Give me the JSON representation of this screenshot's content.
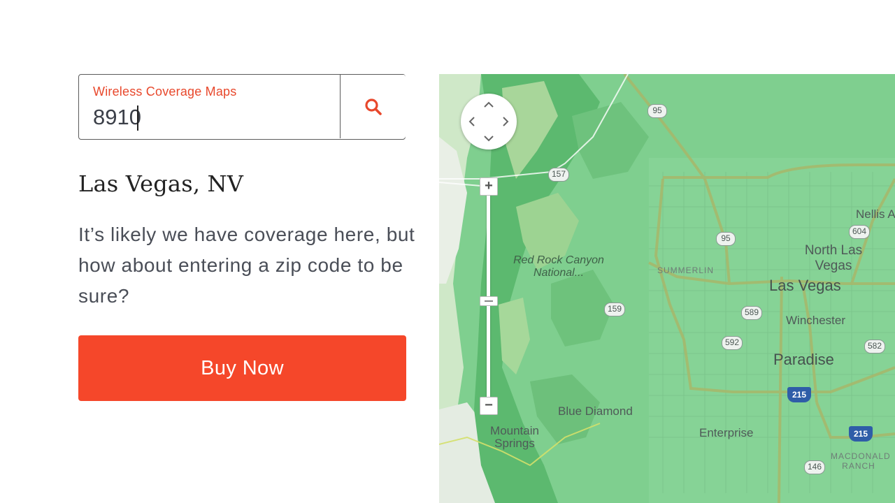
{
  "search": {
    "label": "Wireless Coverage Maps",
    "value": "8910",
    "button_icon": "search-icon"
  },
  "result": {
    "city": "Las Vegas, NV",
    "message": "It’s likely we have coverage here, but how about entering a zip code to be sure?"
  },
  "buy_button": {
    "label": "Buy Now"
  },
  "colors": {
    "accent": "#f5472a",
    "label_orange": "#e8482c",
    "map_coverage_green": "#7fcf8f"
  },
  "map": {
    "controls": {
      "pan_icon": "pan-arrows-icon",
      "zoom_in": "+",
      "zoom_out": "−"
    },
    "places": {
      "nellis": "Nellis A",
      "north_las_vegas": "North Las Vegas",
      "summerlin": "SUMMERLIN",
      "red_rock": "Red Rock Canyon National...",
      "las_vegas": "Las Vegas",
      "winchester": "Winchester",
      "paradise": "Paradise",
      "blue_diamond": "Blue Diamond",
      "mountain_springs": "Mountain Springs",
      "enterprise": "Enterprise",
      "macdonald_ranch": "MACDONALD RANCH"
    },
    "route_shields": {
      "r95_top": "95",
      "r157": "157",
      "r604": "604",
      "r95_mid": "95",
      "r589": "589",
      "r159": "159",
      "r592": "592",
      "r582": "582",
      "r215_a": "215",
      "r215_b": "215",
      "r146": "146"
    }
  }
}
